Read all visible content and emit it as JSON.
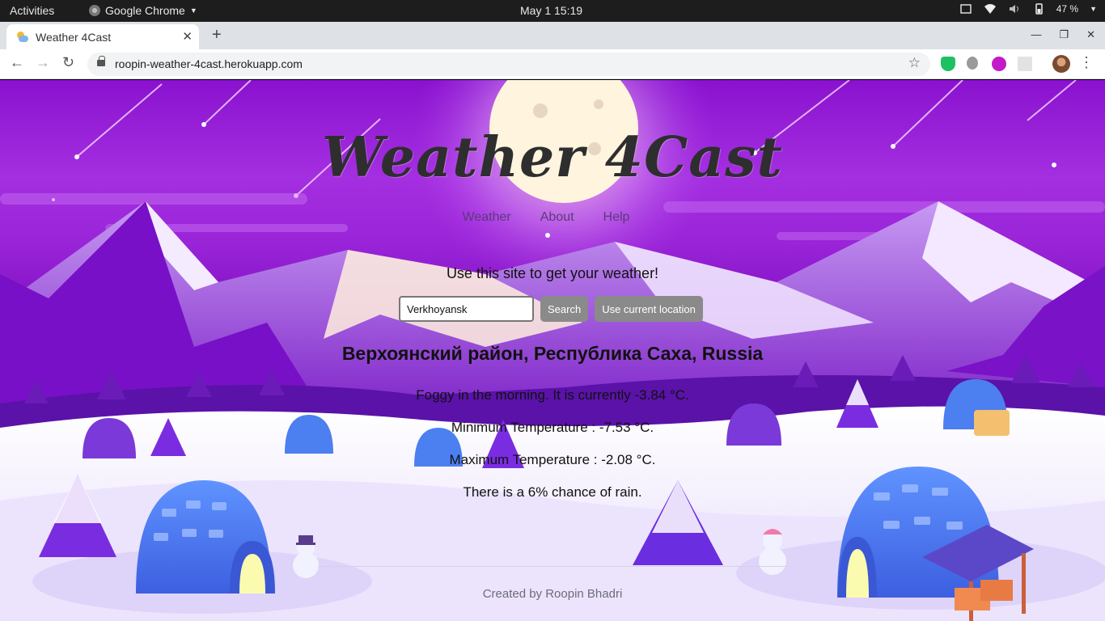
{
  "system": {
    "activities": "Activities",
    "app_name": "Google Chrome",
    "clock": "May 1  15:19",
    "battery": "47 %"
  },
  "browser": {
    "tab_title": "Weather 4Cast",
    "url": "roopin-weather-4cast.herokuapp.com"
  },
  "site": {
    "logo": "Weather 4Cast",
    "nav": {
      "weather": "Weather",
      "about": "About",
      "help": "Help"
    },
    "intro": "Use this site to get your weather!",
    "search": {
      "value": "Verkhoyansk",
      "button": "Search",
      "location_button": "Use current location"
    },
    "result": {
      "location": "Верхоянский район, Республика Саха, Russia",
      "summary": "Foggy in the morning. It is currently -3.84 °C.",
      "min": "Minimum Temperature : -7.53 °C.",
      "max": "Maximum Temperature : -2.08 °C.",
      "rain": "There is a 6% chance of rain."
    },
    "footer": "Created by Roopin Bhadri"
  },
  "colors": {
    "sky": "#8a12cf",
    "moon": "#fff6e0",
    "snow": "#f4f0ff",
    "igloo": "#4a7df0",
    "button": "#8a8a8a"
  }
}
